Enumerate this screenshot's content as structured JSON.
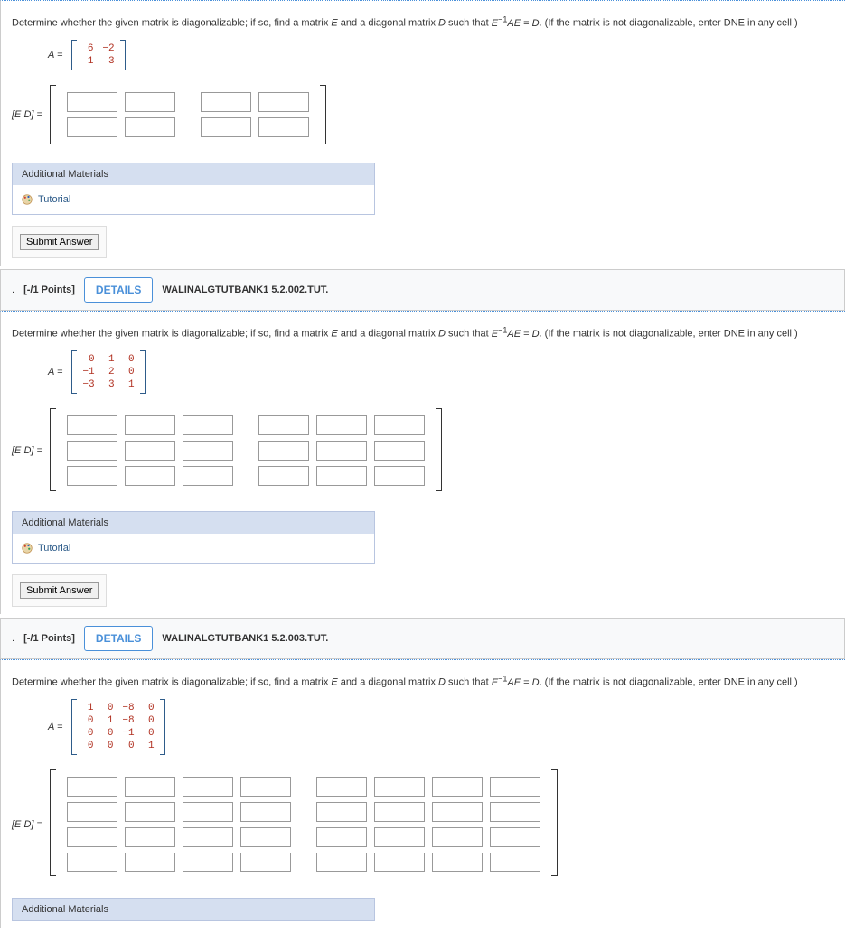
{
  "questions": [
    {
      "prompt_prefix": "Determine whether the given matrix is diagonalizable; if so, find a matrix ",
      "prompt_mid1": " and a diagonal matrix ",
      "prompt_mid2": " such that ",
      "prompt_suffix": ". (If the matrix is not diagonalizable, enter DNE in any cell.)",
      "E": "E",
      "D": "D",
      "eq_lhs": "E",
      "eq_inv": "−1",
      "eq_rhs1": "AE",
      "eq_eq": " = ",
      "eq_rhs2": "D",
      "A_label": "A =",
      "A": [
        [
          "6",
          "−2"
        ],
        [
          "1",
          "3"
        ]
      ],
      "ED_label": "[E D] =",
      "rows": 2,
      "E_cols": 2,
      "D_cols": 2,
      "add_mat": "Additional Materials",
      "tut": "Tutorial",
      "submit": "Submit Answer"
    },
    {
      "header": {
        "points": "[-/1 Points]",
        "details": "DETAILS",
        "ref": "WALINALGTUTBANK1 5.2.002.TUT."
      },
      "prompt_prefix": "Determine whether the given matrix is diagonalizable; if so, find a matrix ",
      "prompt_mid1": " and a diagonal matrix ",
      "prompt_mid2": " such that ",
      "prompt_suffix": ". (If the matrix is not diagonalizable, enter DNE in any cell.)",
      "E": "E",
      "D": "D",
      "eq_lhs": "E",
      "eq_inv": "−1",
      "eq_rhs1": "AE",
      "eq_eq": " = ",
      "eq_rhs2": "D",
      "A_label": "A =",
      "A": [
        [
          "0",
          "1",
          "0"
        ],
        [
          "−1",
          "2",
          "0"
        ],
        [
          "−3",
          "3",
          "1"
        ]
      ],
      "ED_label": "[E D] =",
      "rows": 3,
      "E_cols": 3,
      "D_cols": 3,
      "add_mat": "Additional Materials",
      "tut": "Tutorial",
      "submit": "Submit Answer"
    },
    {
      "header": {
        "points": "[-/1 Points]",
        "details": "DETAILS",
        "ref": "WALINALGTUTBANK1 5.2.003.TUT."
      },
      "prompt_prefix": "Determine whether the given matrix is diagonalizable; if so, find a matrix ",
      "prompt_mid1": " and a diagonal matrix ",
      "prompt_mid2": " such that ",
      "prompt_suffix": ". (If the matrix is not diagonalizable, enter DNE in any cell.)",
      "E": "E",
      "D": "D",
      "eq_lhs": "E",
      "eq_inv": "−1",
      "eq_rhs1": "AE",
      "eq_eq": " = ",
      "eq_rhs2": "D",
      "A_label": "A =",
      "A": [
        [
          "1",
          "0",
          "−8",
          "0"
        ],
        [
          "0",
          "1",
          "−8",
          "0"
        ],
        [
          "0",
          "0",
          "−1",
          "0"
        ],
        [
          "0",
          "0",
          "0",
          "1"
        ]
      ],
      "ED_label": "[E D] =",
      "rows": 4,
      "E_cols": 4,
      "D_cols": 4,
      "add_mat": "Additional Materials"
    }
  ]
}
